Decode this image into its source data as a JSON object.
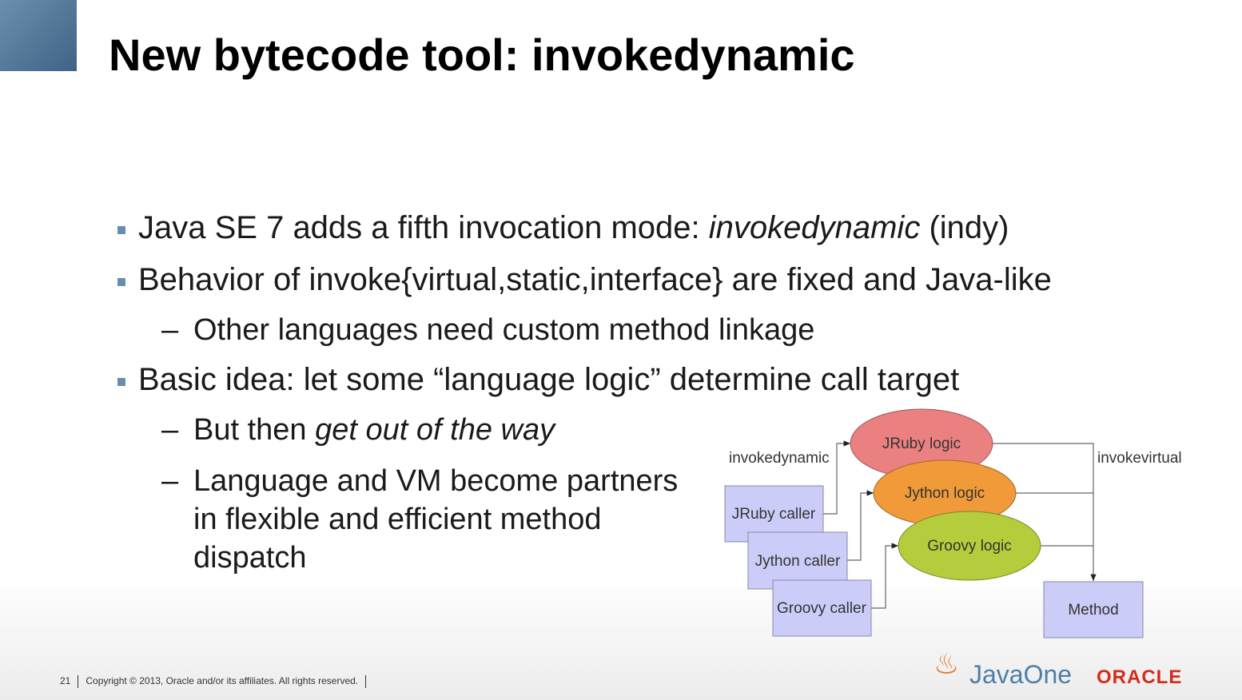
{
  "title": "New bytecode tool: invokedynamic",
  "bullets": {
    "b1_pre": "Java SE 7 adds a fifth invocation mode: ",
    "b1_em": "invokedynamic",
    "b1_post": " (indy)",
    "b2": "Behavior of invoke{virtual,static,interface} are fixed and Java-like",
    "b2_sub": "Other languages need custom method linkage",
    "b3": "Basic idea: let some “language logic” determine call target",
    "b3_sub1_pre": "But then ",
    "b3_sub1_em": "get out of the way",
    "b3_sub2_l1": "Language and VM become partners",
    "b3_sub2_l2": "in flexible and efficient method",
    "b3_sub2_l3": "dispatch",
    "dash": "–"
  },
  "diagram": {
    "label_left": "invokedynamic",
    "label_right": "invokevirtual",
    "jruby_logic": "JRuby logic",
    "jython_logic": "Jython logic",
    "groovy_logic": "Groovy logic",
    "jruby_caller": "JRuby caller",
    "jython_caller": "Jython caller",
    "groovy_caller": "Groovy caller",
    "method": "Method",
    "colors": {
      "jruby": "#ea8080",
      "jython": "#f09a3a",
      "groovy": "#b5cc3c",
      "box": "#ccccf8"
    }
  },
  "footer": {
    "page": "21",
    "copyright": "Copyright © 2013, Oracle and/or its affiliates. All rights reserved.",
    "javaone": "JavaOne",
    "oracle": "ORACLE"
  }
}
